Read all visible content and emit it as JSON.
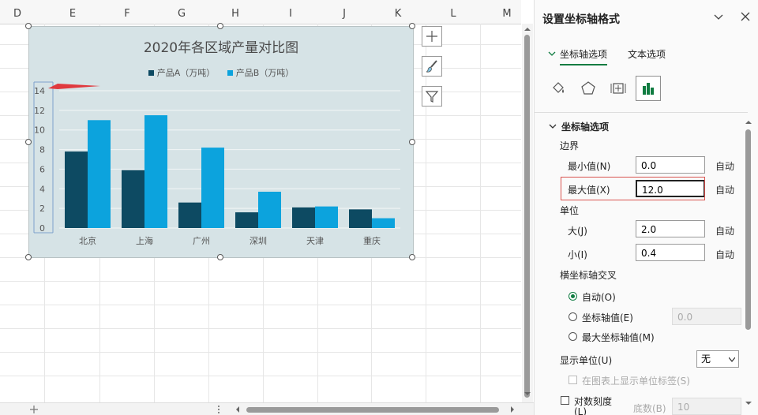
{
  "spreadsheet": {
    "columns": [
      "D",
      "E",
      "F",
      "G",
      "H",
      "I",
      "J",
      "K",
      "L",
      "M"
    ]
  },
  "chart": {
    "title": "2020年各区域产量对比图",
    "legend": [
      "产品A（万吨）",
      "产品B（万吨）"
    ],
    "colors": {
      "series_a": "#0d4a62",
      "series_b": "#0ca3dd",
      "plot_bg": "#d6e3e6",
      "gridline": "#eef3f4"
    }
  },
  "chart_data": {
    "type": "bar",
    "title": "2020年各区域产量对比图",
    "categories": [
      "北京",
      "上海",
      "广州",
      "深圳",
      "天津",
      "重庆"
    ],
    "series": [
      {
        "name": "产品A（万吨）",
        "values": [
          7.8,
          5.9,
          2.6,
          1.6,
          2.1,
          1.9
        ]
      },
      {
        "name": "产品B（万吨）",
        "values": [
          11.0,
          11.5,
          8.2,
          3.7,
          2.2,
          1.0
        ]
      }
    ],
    "yticks": [
      0,
      2,
      4,
      6,
      8,
      10,
      12,
      14
    ],
    "ylim": [
      0,
      14
    ],
    "grid": true,
    "legend_position": "top"
  },
  "panel": {
    "title": "设置坐标轴格式",
    "tabs": [
      "坐标轴选项",
      "文本选项"
    ],
    "section": "坐标轴选项",
    "bounds_label": "边界",
    "min_label": "最小值(N)",
    "min_value": "0.0",
    "max_label": "最大值(X)",
    "max_value": "12.0",
    "auto": "自动",
    "units_label": "单位",
    "major_label": "大(J)",
    "major_value": "2.0",
    "minor_label": "小(I)",
    "minor_value": "0.4",
    "cross_label": "横坐标轴交叉",
    "cross_auto": "自动(O)",
    "cross_value_label": "坐标轴值(E)",
    "cross_value": "0.0",
    "cross_max": "最大坐标轴值(M)",
    "display_units_label": "显示单位(U)",
    "display_units_value": "无",
    "show_units_label": "在图表上显示单位标签(S)",
    "log_label": "对数刻度",
    "log_label2": "(L)",
    "base_label": "底数(B)",
    "base_value": "10"
  }
}
